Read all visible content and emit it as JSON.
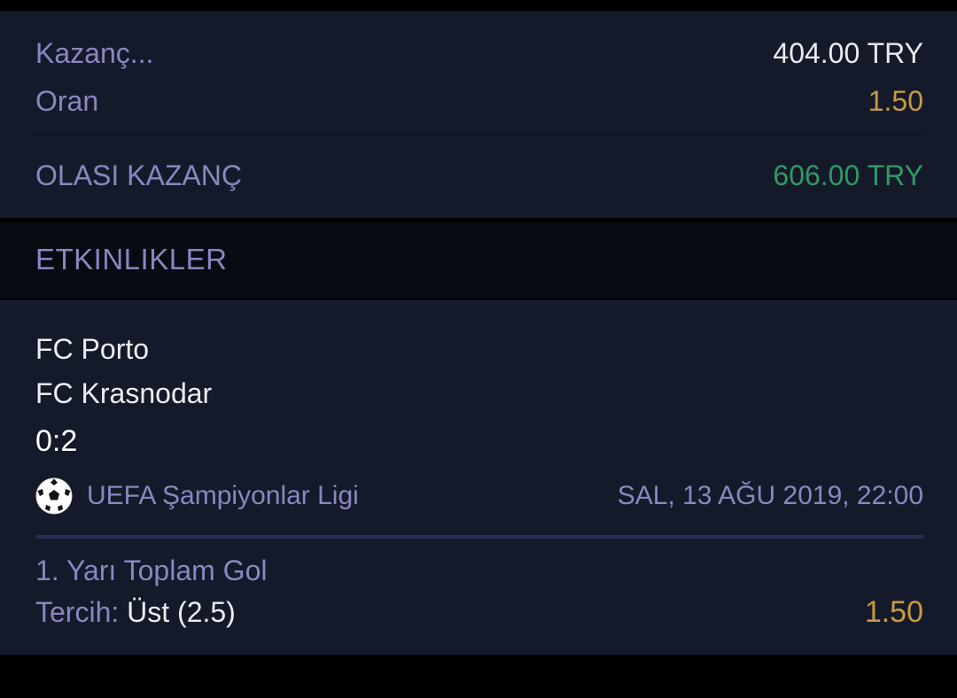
{
  "summary": {
    "stake_label": "Kazanç...",
    "stake_value": "404.00 TRY",
    "odds_label": "Oran",
    "odds_value": "1.50",
    "potential_label": "OLASI KAZANÇ",
    "potential_value": "606.00 TRY"
  },
  "events_section": {
    "title": "ETKINLIKLER"
  },
  "event": {
    "home_team": "FC Porto",
    "away_team": "FC Krasnodar",
    "score": "0:2",
    "league_icon": "soccer-ball-icon",
    "league": "UEFA Şampiyonlar Ligi",
    "datetime": "SAL, 13 AĞU 2019, 22:00",
    "market": "1. Yarı Toplam Gol",
    "pick_label": "Tercih:",
    "pick_value": "Üst (2.5)",
    "pick_odds": "1.50"
  },
  "colors": {
    "background": "#000000",
    "card": "#151a2a",
    "muted_text": "#8a86c0",
    "odds_gold": "#c69a42",
    "win_green": "#2f9a62",
    "divider_blue": "#262c5a"
  }
}
